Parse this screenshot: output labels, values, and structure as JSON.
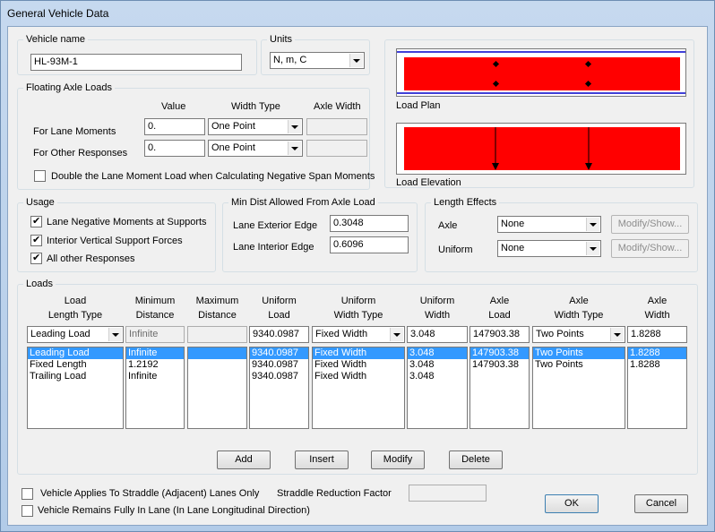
{
  "window": {
    "title": "General Vehicle Data"
  },
  "vehicle_name": {
    "label": "Vehicle name",
    "value": "HL-93M-1"
  },
  "units": {
    "label": "Units",
    "value": "N, m, C"
  },
  "floating_axle": {
    "label": "Floating Axle Loads",
    "col_value": "Value",
    "col_width_type": "Width Type",
    "col_axle_width": "Axle Width",
    "lane_moments": {
      "label": "For Lane Moments",
      "value": "0.",
      "width_type": "One Point",
      "axle_width": ""
    },
    "other_responses": {
      "label": "For Other Responses",
      "value": "0.",
      "width_type": "One Point",
      "axle_width": ""
    },
    "double_label": "Double the Lane Moment Load when Calculating Negative Span Moments",
    "double_checked": false
  },
  "load_plan": {
    "caption": "Load Plan"
  },
  "load_elevation": {
    "caption": "Load Elevation"
  },
  "usage": {
    "label": "Usage",
    "items": [
      {
        "label": "Lane Negative Moments at Supports",
        "checked": true
      },
      {
        "label": "Interior Vertical Support Forces",
        "checked": true
      },
      {
        "label": "All other Responses",
        "checked": true
      }
    ]
  },
  "min_dist": {
    "label": "Min Dist Allowed From Axle Load",
    "exterior_label": "Lane Exterior Edge",
    "exterior_value": "0.3048",
    "interior_label": "Lane Interior Edge",
    "interior_value": "0.6096"
  },
  "length_effects": {
    "label": "Length Effects",
    "axle_label": "Axle",
    "axle_value": "None",
    "uniform_label": "Uniform",
    "uniform_value": "None",
    "modify_label": "Modify/Show..."
  },
  "loads": {
    "label": "Loads",
    "headers": [
      [
        "Load",
        "Length Type"
      ],
      [
        "Minimum",
        "Distance"
      ],
      [
        "Maximum",
        "Distance"
      ],
      [
        "Uniform",
        "Load"
      ],
      [
        "Uniform",
        "Width Type"
      ],
      [
        "Uniform",
        "Width"
      ],
      [
        "Axle",
        "Load"
      ],
      [
        "Axle",
        "Width Type"
      ],
      [
        "Axle",
        "Width"
      ]
    ],
    "edit_row": {
      "length_type": "Leading Load",
      "min_dist": "Infinite",
      "max_dist": "",
      "uniform_load": "9340.0987",
      "uniform_width_type": "Fixed Width",
      "uniform_width": "3.048",
      "axle_load": "147903.38",
      "axle_width_type": "Two Points",
      "axle_width": "1.8288"
    },
    "columns": [
      [
        "Leading Load",
        "Fixed Length",
        "Trailing Load"
      ],
      [
        "Infinite",
        "1.2192",
        "Infinite"
      ],
      [
        "",
        "",
        ""
      ],
      [
        "9340.0987",
        "9340.0987",
        "9340.0987"
      ],
      [
        "Fixed Width",
        "Fixed Width",
        "Fixed Width"
      ],
      [
        "3.048",
        "3.048",
        "3.048"
      ],
      [
        "147903.38",
        "147903.38",
        ""
      ],
      [
        "Two Points",
        "Two Points",
        ""
      ],
      [
        "1.8288",
        "1.8288",
        ""
      ]
    ],
    "selected_row": 0,
    "buttons": {
      "add": "Add",
      "insert": "Insert",
      "modify": "Modify",
      "delete": "Delete"
    }
  },
  "straddle": {
    "applies_label": "Vehicle Applies To Straddle (Adjacent) Lanes Only",
    "factor_label": "Straddle Reduction Factor",
    "factor_value": "",
    "remains_label": "Vehicle Remains Fully In Lane (In Lane Longitudinal Direction)"
  },
  "dialog_buttons": {
    "ok": "OK",
    "cancel": "Cancel"
  },
  "colors": {
    "load_fill": "#ff0000",
    "lane_line": "#0000cc",
    "selection": "#3399ff"
  }
}
